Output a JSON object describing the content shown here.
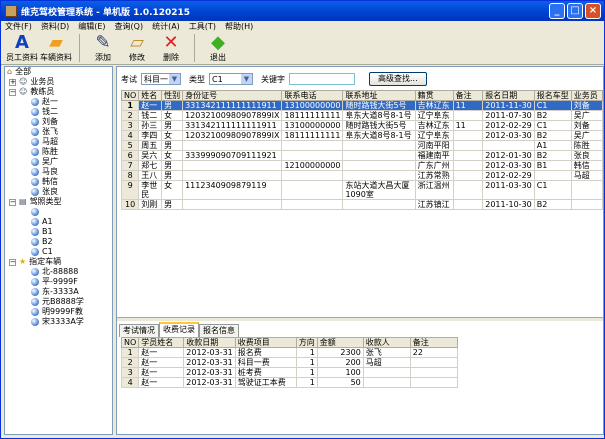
{
  "title": "维克驾校管理系统 - 单机版 1.0.120215",
  "menu": [
    "文件(F)",
    "资料(D)",
    "编辑(E)",
    "查询(Q)",
    "统计(A)",
    "工具(T)",
    "帮助(H)"
  ],
  "toolbar": {
    "staff": "员工资料",
    "vehicle": "车辆资料",
    "add": "添加",
    "edit": "修改",
    "delete": "删除",
    "exit": "退出"
  },
  "tree": {
    "root": "全部",
    "salesman": "业务员",
    "coach": "教练员",
    "coaches": [
      "赵一",
      "钱二",
      "刘备",
      "张飞",
      "马超",
      "陈胜",
      "吴广",
      "马良",
      "韩信",
      "张良"
    ],
    "license": "驾照类型",
    "licenses": [
      "",
      "A1",
      "B1",
      "B2",
      "C1"
    ],
    "cars": "指定车辆",
    "car_list": [
      "北-88888",
      "平-9999F",
      "东-3333A",
      "元B8888学",
      "明9999F教",
      "宋3333A学"
    ]
  },
  "filter": {
    "exam_label": "考试",
    "exam_value": "科目一",
    "type_label": "类型",
    "type_value": "C1",
    "keyword_label": "关键字",
    "keyword_value": "",
    "advanced": "高级查找..."
  },
  "students": {
    "columns": [
      "NO",
      "姓名",
      "性别",
      "身份证号",
      "联系电话",
      "联系地址",
      "籍贯",
      "备注",
      "报名日期",
      "报名车型",
      "业务员"
    ],
    "rows": [
      [
        "1",
        "赵一",
        "男",
        "331342111111111911",
        "13100000000",
        "随时路钱大街5号",
        "吉林辽东",
        "11",
        "2011-11-30",
        "C1",
        "刘备"
      ],
      [
        "2",
        "钱二",
        "女",
        "12032100980907899IX",
        "18111111111",
        "阜东大道8号8-1号",
        "辽宁阜东",
        "",
        "2011-07-30",
        "B2",
        "吴广"
      ],
      [
        "3",
        "孙三",
        "男",
        "331342111111111911",
        "13100000000",
        "随时路钱大街5号",
        "吉林辽东",
        "11",
        "2012-02-29",
        "C1",
        "刘备"
      ],
      [
        "4",
        "李四",
        "女",
        "12032100980907899IX",
        "18111111111",
        "阜东大道8号8-1号",
        "辽宁阜东",
        "",
        "2012-03-30",
        "B2",
        "吴广"
      ],
      [
        "5",
        "周五",
        "男",
        "",
        "",
        "",
        "河南平阳",
        "",
        "",
        "A1",
        "陈胜"
      ],
      [
        "6",
        "吴六",
        "女",
        "333999090709111921",
        "",
        "",
        "福建南平",
        "",
        "2012-01-30",
        "B2",
        "张良"
      ],
      [
        "7",
        "郑七",
        "男",
        "",
        "12100000000",
        "",
        "广东广州",
        "",
        "2012-03-30",
        "B1",
        "韩信"
      ],
      [
        "8",
        "王八",
        "男",
        "",
        "",
        "",
        "江苏常熟",
        "",
        "2012-02-29",
        "",
        "马超"
      ],
      [
        "9",
        "李世民",
        "女",
        "1112340909879119",
        "",
        "东站大道大昌大厦1090室",
        "浙江温州",
        "",
        "2011-03-30",
        "C1",
        ""
      ],
      [
        "10",
        "刘刚",
        "男",
        "",
        "",
        "",
        "江苏镇江",
        "",
        "2011-10-30",
        "B2",
        ""
      ]
    ]
  },
  "tabs": [
    "考试情况",
    "收费记录",
    "报名信息"
  ],
  "payments": {
    "columns": [
      "NO",
      "学员姓名",
      "收款日期",
      "收费项目",
      "方向",
      "金额",
      "收款人",
      "备注"
    ],
    "rows": [
      [
        "1",
        "赵一",
        "2012-03-31",
        "报名费",
        "1",
        "2300",
        "张飞",
        "22"
      ],
      [
        "2",
        "赵一",
        "2012-03-31",
        "科目一费",
        "1",
        "200",
        "马超",
        ""
      ],
      [
        "3",
        "赵一",
        "2012-03-31",
        "桩考费",
        "1",
        "100",
        "",
        ""
      ],
      [
        "4",
        "赵一",
        "2012-03-31",
        "驾驶证工本费",
        "1",
        "50",
        "",
        ""
      ]
    ]
  }
}
